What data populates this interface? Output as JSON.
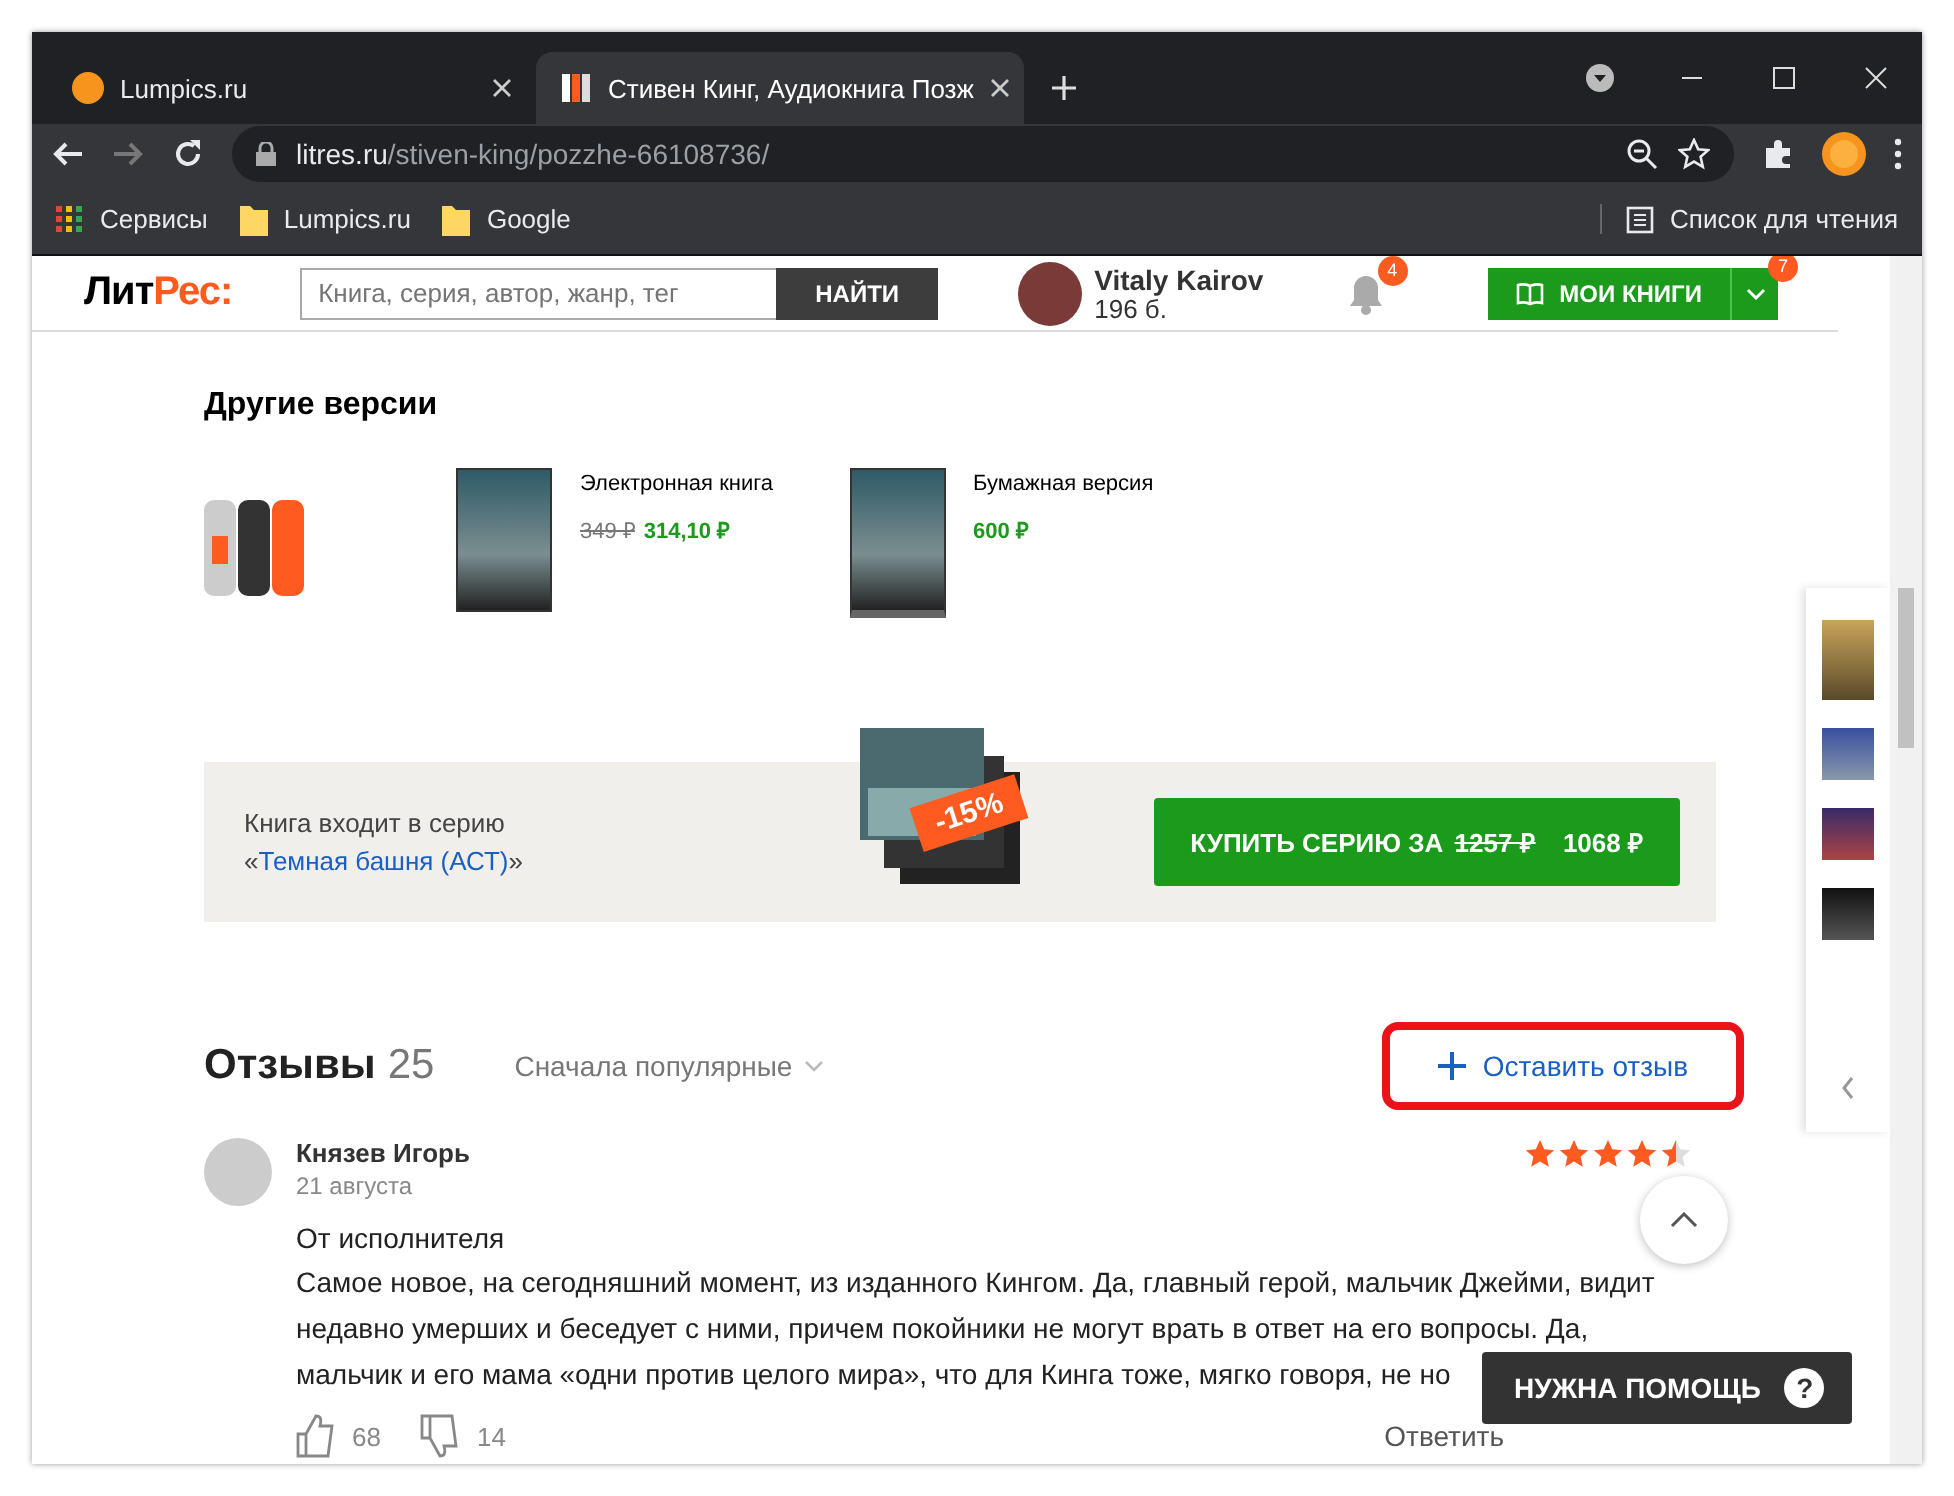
{
  "browser": {
    "tabs": [
      {
        "title": "Lumpics.ru",
        "selected": false
      },
      {
        "title": "Стивен Кинг, Аудиокнига Позж",
        "selected": true
      }
    ],
    "address": {
      "host": "litres.ru",
      "path": "/stiven-king/pozzhe-66108736/"
    },
    "bookmarks": [
      {
        "kind": "apps",
        "label": "Сервисы"
      },
      {
        "kind": "folder",
        "label": "Lumpics.ru"
      },
      {
        "kind": "folder",
        "label": "Google"
      }
    ],
    "reading_list": "Список для чтения"
  },
  "header": {
    "logo": [
      "Лит",
      "Рес:"
    ],
    "search": {
      "placeholder": "Книга, серия, автор, жанр, тег",
      "button": "НАЙТИ"
    },
    "user": {
      "name": "Vitaly Kairov",
      "points": "196 б."
    },
    "notifications": "4",
    "my_books": {
      "label": "МОИ КНИГИ",
      "badge": "7"
    }
  },
  "other_versions": {
    "title": "Другие версии",
    "items": [
      {
        "kind": "audio"
      },
      {
        "kind": "ebook",
        "label": "Электронная книга",
        "old_price": "349 ₽",
        "price": "314,10 ₽"
      },
      {
        "kind": "paper",
        "label": "Бумажная версия",
        "price": "600 ₽"
      }
    ]
  },
  "series": {
    "text": "Книга входит в серию",
    "link": "Темная башня (АСТ)",
    "quote_open": "«",
    "quote_close": "»",
    "discount": "-15%",
    "button": {
      "label": "КУПИТЬ СЕРИЮ ЗА",
      "old_price": "1257 ₽",
      "price": "1068 ₽"
    }
  },
  "reviews": {
    "title": "Отзывы",
    "count": "25",
    "sort": "Сначала популярные",
    "add": {
      "label": "Оставить отзыв",
      "highlighted": true
    },
    "items": [
      {
        "author": "Князев Игорь",
        "date": "21 августа",
        "stars": 4.5,
        "heading": "От исполнителя",
        "text_lines": [
          "Самое новое, на сегодняшний момент, из изданного Кингом. Да, главный герой, мальчик Джейми, видит",
          "недавно умерших и беседует с ними, причем покойники не могут врать в ответ на его вопросы. Да,",
          "мальчик и его мама «одни против целого мира», что для Кинга тоже, мягко говоря, не но"
        ],
        "likes": "68",
        "dislikes": "14",
        "reply": "Ответить"
      }
    ]
  },
  "help": {
    "label": "НУЖНА ПОМОЩЬ",
    "glyph": "?"
  }
}
